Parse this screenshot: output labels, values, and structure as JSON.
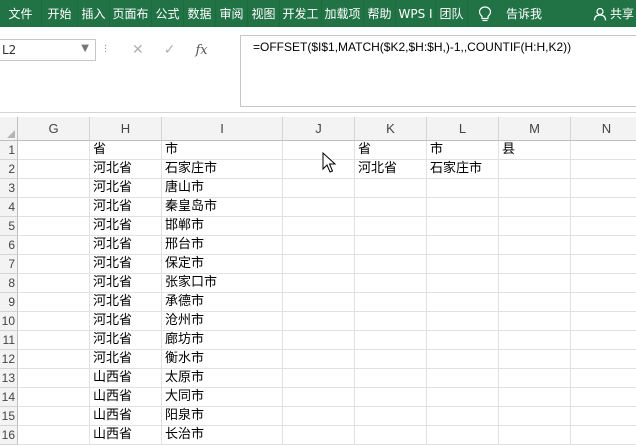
{
  "ribbon": {
    "tabs": [
      "文件",
      "开始",
      "插入",
      "页面布",
      "公式",
      "数据",
      "审阅",
      "视图",
      "开发工",
      "加载项",
      "帮助",
      "WPS I",
      "团队"
    ],
    "tell_me": "告诉我",
    "share": "共享"
  },
  "formula_bar": {
    "name_box": "L2",
    "formula": "=OFFSET($I$1,MATCH($K2,$H:$H,)-1,,COUNTIF(H:H,K2))"
  },
  "columns": [
    "G",
    "H",
    "I",
    "J",
    "K",
    "L",
    "M",
    "N"
  ],
  "rows": [
    {
      "num": "1",
      "H": "省",
      "I": "市",
      "K": "省",
      "L": "市",
      "M": "县"
    },
    {
      "num": "2",
      "H": "河北省",
      "I": "石家庄市",
      "K": "河北省",
      "L": "石家庄市"
    },
    {
      "num": "3",
      "H": "河北省",
      "I": "唐山市"
    },
    {
      "num": "4",
      "H": "河北省",
      "I": "秦皇岛市"
    },
    {
      "num": "5",
      "H": "河北省",
      "I": "邯郸市"
    },
    {
      "num": "6",
      "H": "河北省",
      "I": "邢台市"
    },
    {
      "num": "7",
      "H": "河北省",
      "I": "保定市"
    },
    {
      "num": "8",
      "H": "河北省",
      "I": "张家口市"
    },
    {
      "num": "9",
      "H": "河北省",
      "I": "承德市"
    },
    {
      "num": "10",
      "H": "河北省",
      "I": "沧州市"
    },
    {
      "num": "11",
      "H": "河北省",
      "I": "廊坊市"
    },
    {
      "num": "12",
      "H": "河北省",
      "I": "衡水市"
    },
    {
      "num": "13",
      "H": "山西省",
      "I": "太原市"
    },
    {
      "num": "14",
      "H": "山西省",
      "I": "大同市"
    },
    {
      "num": "15",
      "H": "山西省",
      "I": "阳泉市"
    },
    {
      "num": "16",
      "H": "山西省",
      "I": "长治市"
    }
  ],
  "colors": {
    "ribbon": "#217346"
  }
}
